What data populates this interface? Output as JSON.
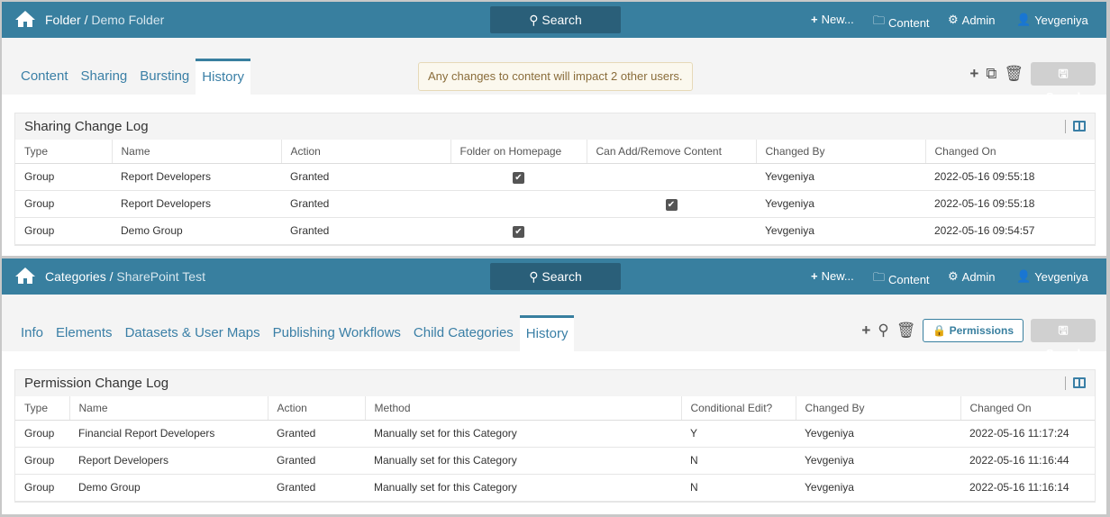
{
  "panel1": {
    "crumb_root": "Folder",
    "crumb_sub": "Demo Folder",
    "search": "Search",
    "new": "New...",
    "content": "Content",
    "admin": "Admin",
    "user": "Yevgeniya",
    "tabs": [
      "Content",
      "Sharing",
      "Bursting",
      "History"
    ],
    "notice": "Any changes to content will impact 2 other users.",
    "saved": "Saved",
    "card_title": "Sharing Change Log",
    "columns": [
      "Type",
      "Name",
      "Action",
      "Folder on Homepage",
      "Can Add/Remove Content",
      "Changed By",
      "Changed On"
    ],
    "rows": [
      {
        "type": "Group",
        "name": "Report Developers",
        "action": "Granted",
        "homepage": true,
        "canadd": false,
        "by": "Yevgeniya",
        "on": "2022-05-16 09:55:18"
      },
      {
        "type": "Group",
        "name": "Report Developers",
        "action": "Granted",
        "homepage": false,
        "canadd": true,
        "by": "Yevgeniya",
        "on": "2022-05-16 09:55:18"
      },
      {
        "type": "Group",
        "name": "Demo Group",
        "action": "Granted",
        "homepage": true,
        "canadd": false,
        "by": "Yevgeniya",
        "on": "2022-05-16 09:54:57"
      }
    ]
  },
  "panel2": {
    "crumb_root": "Categories",
    "crumb_sub": "SharePoint Test",
    "search": "Search",
    "new": "New...",
    "content": "Content",
    "admin": "Admin",
    "user": "Yevgeniya",
    "tabs": [
      "Info",
      "Elements",
      "Datasets & User Maps",
      "Publishing Workflows",
      "Child Categories",
      "History"
    ],
    "permissions": "Permissions",
    "saved": "Saved",
    "card_title": "Permission Change Log",
    "columns": [
      "Type",
      "Name",
      "Action",
      "Method",
      "Conditional Edit?",
      "Changed By",
      "Changed On"
    ],
    "rows": [
      {
        "type": "Group",
        "name": "Financial Report Developers",
        "action": "Granted",
        "method": "Manually set for this Category",
        "cond": "Y",
        "by": "Yevgeniya",
        "on": "2022-05-16 11:17:24"
      },
      {
        "type": "Group",
        "name": "Report Developers",
        "action": "Granted",
        "method": "Manually set for this Category",
        "cond": "N",
        "by": "Yevgeniya",
        "on": "2022-05-16 11:16:44"
      },
      {
        "type": "Group",
        "name": "Demo Group",
        "action": "Granted",
        "method": "Manually set for this Category",
        "cond": "N",
        "by": "Yevgeniya",
        "on": "2022-05-16 11:16:14"
      }
    ]
  }
}
